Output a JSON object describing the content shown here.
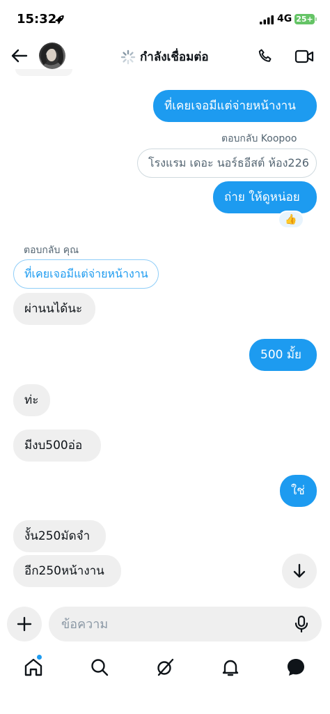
{
  "status_bar": {
    "time": "15:32",
    "network": "4G",
    "battery": "25+"
  },
  "header": {
    "title": "กำลังเชื่อมต่อ"
  },
  "messages": {
    "m1": "ที่เคยเจอมีแต่จ่ายหน้างาน",
    "m2_reply_label": "ตอบกลับ Koopoo",
    "m2_reply_quote": "โรงแรม เดอะ นอร์ธอีสต์ ห้อง226",
    "m2": "ถ่าย ให้ดูหน่อย",
    "m2_reaction": "👍",
    "m3_reply_label": "ตอบกลับ คุณ",
    "m3_reply_quote": "ที่เคยเจอมีแต่จ่ายหน้างาน",
    "m3": "ผ่านนได้นะ",
    "m4": "500 มั้ย",
    "m5": "ท่ะ",
    "m6": "มีงบ500อ่อ",
    "m7": "ใช่",
    "m8": "งั้น250มัดจำ",
    "m9": "อีก250หน้างาน"
  },
  "composer": {
    "placeholder": "ข้อความ"
  },
  "colors": {
    "accent": "#1d9bf0",
    "incoming_bubble": "#efefef",
    "battery": "#65c466"
  },
  "icons": [
    "back-arrow-icon",
    "spinner-icon",
    "phone-icon",
    "video-icon",
    "thumbs-up-icon",
    "arrow-down-icon",
    "plus-icon",
    "mic-icon",
    "home-icon",
    "search-icon",
    "grok-icon",
    "bell-icon",
    "messages-icon"
  ]
}
